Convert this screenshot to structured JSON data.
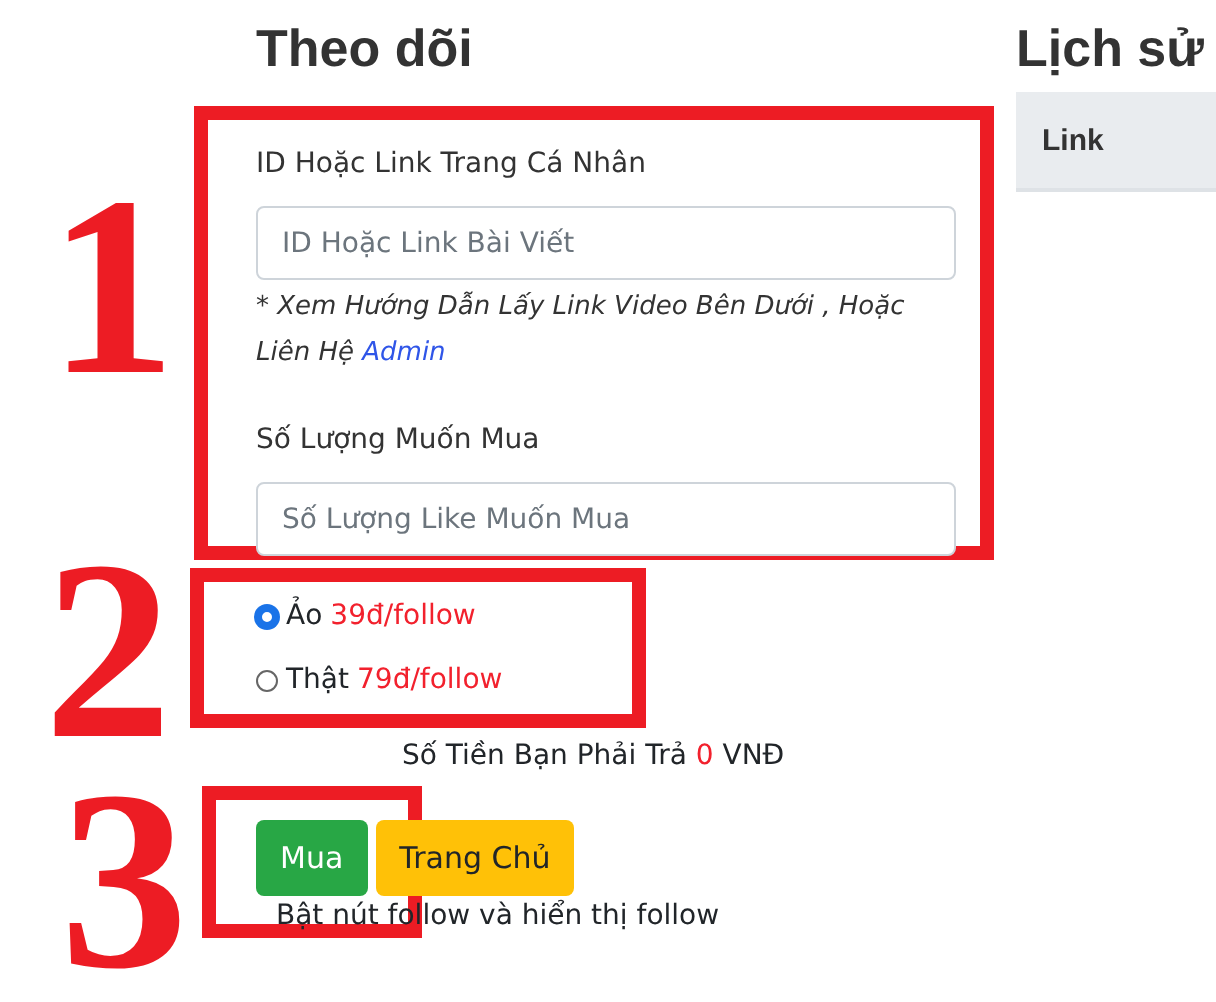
{
  "form": {
    "title": "Theo dõi",
    "fields": [
      {
        "label": "ID Hoặc Link Trang Cá Nhân",
        "placeholder": "ID Hoặc Link Bài Viết",
        "hint": "* Xem Hướng Dẫn Lấy Link Video Bên Dưới , Hoặc Liên Hệ",
        "hint_link": "Admin"
      },
      {
        "label": "Số Lượng Muốn Mua",
        "placeholder": "Số Lượng Like Muốn Mua"
      }
    ],
    "options": [
      {
        "label": "Ảo",
        "price": "39đ/follow",
        "selected": true
      },
      {
        "label": "Thật",
        "price": "79đ/follow",
        "selected": false
      }
    ],
    "total": {
      "label": "Số Tiền Bạn Phải Trả",
      "amount": "0",
      "unit": "VNĐ"
    },
    "buttons": [
      {
        "label": "Mua",
        "kind": "success"
      },
      {
        "label": "Trang Chủ",
        "kind": "warning"
      }
    ],
    "note": "Bật nút follow và hiển thị follow"
  },
  "history": {
    "title": "Lịch sử",
    "columns": [
      "Link"
    ]
  },
  "annotations": [
    {
      "number": "1"
    },
    {
      "number": "2"
    },
    {
      "number": "3"
    }
  ]
}
